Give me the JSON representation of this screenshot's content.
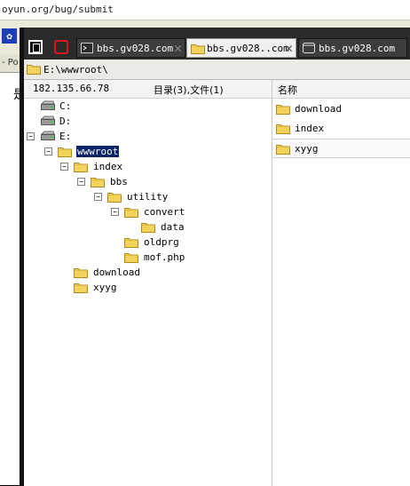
{
  "browser": {
    "url": "oyun.org/bug/submit",
    "tab_fragment": "- Po",
    "page_char": "是"
  },
  "tabs": [
    {
      "label": "bbs.gv028.com",
      "active": false,
      "icon": "terminal-icon"
    },
    {
      "label": "bbs.gv028..com",
      "active": true,
      "icon": "folder-icon"
    },
    {
      "label": "bbs.gv028.com",
      "active": false,
      "icon": "window-icon"
    }
  ],
  "path": "E:\\wwwroot\\",
  "header": {
    "ip": "182.135.66.78",
    "counts": "目录(3),文件(1)",
    "name_col": "名称"
  },
  "tree": [
    {
      "label": "C:",
      "type": "drive",
      "toggle": ""
    },
    {
      "label": "D:",
      "type": "drive",
      "toggle": ""
    },
    {
      "label": "E:",
      "type": "drive",
      "toggle": "−"
    },
    {
      "label": "wwwroot",
      "type": "folder",
      "toggle": "−",
      "selected": true
    },
    {
      "label": "index",
      "type": "folder",
      "toggle": "−"
    },
    {
      "label": "bbs",
      "type": "folder",
      "toggle": "−"
    },
    {
      "label": "utility",
      "type": "folder",
      "toggle": "−"
    },
    {
      "label": "convert",
      "type": "folder",
      "toggle": "−"
    },
    {
      "label": "data",
      "type": "folder",
      "toggle": ""
    },
    {
      "label": "oldprg",
      "type": "folder",
      "toggle": ""
    },
    {
      "label": "mof.php",
      "type": "folder",
      "toggle": ""
    },
    {
      "label": "download",
      "type": "folder",
      "toggle": ""
    },
    {
      "label": "xyyg",
      "type": "folder",
      "toggle": ""
    }
  ],
  "files": [
    {
      "label": "download",
      "selected": false
    },
    {
      "label": "index",
      "selected": false
    },
    {
      "label": "xyyg",
      "selected": true
    }
  ],
  "colors": {
    "selection": "#0a246a",
    "folder": "#f3d35c",
    "chrome_dark": "#2b2b2b",
    "close_red": "#d41c1c"
  }
}
